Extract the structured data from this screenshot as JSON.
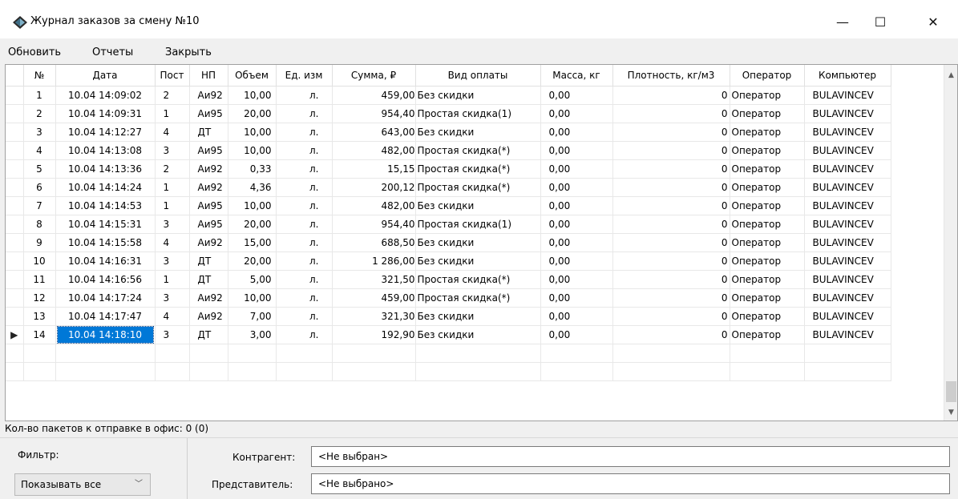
{
  "window": {
    "title": "Журнал заказов за смену №10",
    "minimize_glyph": "—",
    "maximize_glyph": "☐",
    "close_glyph": "✕"
  },
  "menu": {
    "refresh": "Обновить",
    "reports": "Отчеты",
    "close": "Закрыть"
  },
  "grid": {
    "columns": [
      "№",
      "Дата",
      "Пост",
      "НП",
      "Объем",
      "Ед. изм",
      "Сумма, ₽",
      "Вид оплаты",
      "Масса, кг",
      "Плотность, кг/м3",
      "Оператор",
      "Компьютер"
    ],
    "rows": [
      [
        "1",
        "10.04 14:09:02",
        "2",
        "Аи92",
        "10,00",
        "л.",
        "459,00",
        "Без скидки",
        "0,00",
        "0",
        "Оператор",
        "BULAVINCEV"
      ],
      [
        "2",
        "10.04 14:09:31",
        "1",
        "Аи95",
        "20,00",
        "л.",
        "954,40",
        "Простая скидка(1)",
        "0,00",
        "0",
        "Оператор",
        "BULAVINCEV"
      ],
      [
        "3",
        "10.04 14:12:27",
        "4",
        "ДТ",
        "10,00",
        "л.",
        "643,00",
        "Без скидки",
        "0,00",
        "0",
        "Оператор",
        "BULAVINCEV"
      ],
      [
        "4",
        "10.04 14:13:08",
        "3",
        "Аи95",
        "10,00",
        "л.",
        "482,00",
        "Простая скидка(*)",
        "0,00",
        "0",
        "Оператор",
        "BULAVINCEV"
      ],
      [
        "5",
        "10.04 14:13:36",
        "2",
        "Аи92",
        "0,33",
        "л.",
        "15,15",
        "Простая скидка(*)",
        "0,00",
        "0",
        "Оператор",
        "BULAVINCEV"
      ],
      [
        "6",
        "10.04 14:14:24",
        "1",
        "Аи92",
        "4,36",
        "л.",
        "200,12",
        "Простая скидка(*)",
        "0,00",
        "0",
        "Оператор",
        "BULAVINCEV"
      ],
      [
        "7",
        "10.04 14:14:53",
        "1",
        "Аи95",
        "10,00",
        "л.",
        "482,00",
        "Без скидки",
        "0,00",
        "0",
        "Оператор",
        "BULAVINCEV"
      ],
      [
        "8",
        "10.04 14:15:31",
        "3",
        "Аи95",
        "20,00",
        "л.",
        "954,40",
        "Простая скидка(1)",
        "0,00",
        "0",
        "Оператор",
        "BULAVINCEV"
      ],
      [
        "9",
        "10.04 14:15:58",
        "4",
        "Аи92",
        "15,00",
        "л.",
        "688,50",
        "Без скидки",
        "0,00",
        "0",
        "Оператор",
        "BULAVINCEV"
      ],
      [
        "10",
        "10.04 14:16:31",
        "3",
        "ДТ",
        "20,00",
        "л.",
        "1 286,00",
        "Без скидки",
        "0,00",
        "0",
        "Оператор",
        "BULAVINCEV"
      ],
      [
        "11",
        "10.04 14:16:56",
        "1",
        "ДТ",
        "5,00",
        "л.",
        "321,50",
        "Простая скидка(*)",
        "0,00",
        "0",
        "Оператор",
        "BULAVINCEV"
      ],
      [
        "12",
        "10.04 14:17:24",
        "3",
        "Аи92",
        "10,00",
        "л.",
        "459,00",
        "Простая скидка(*)",
        "0,00",
        "0",
        "Оператор",
        "BULAVINCEV"
      ],
      [
        "13",
        "10.04 14:17:47",
        "4",
        "Аи92",
        "7,00",
        "л.",
        "321,30",
        "Без скидки",
        "0,00",
        "0",
        "Оператор",
        "BULAVINCEV"
      ],
      [
        "14",
        "10.04 14:18:10",
        "3",
        "ДТ",
        "3,00",
        "л.",
        "192,90",
        "Без скидки",
        "0,00",
        "0",
        "Оператор",
        "BULAVINCEV"
      ]
    ],
    "selected_row_index": 13,
    "selected_column": "Дата",
    "selection_color": "#0078d7",
    "current_row_marker": "▶"
  },
  "status": {
    "packets_text": "Кол-во пакетов к отправке в офис: 0 (0)"
  },
  "filter": {
    "label": "Фильтр:",
    "selected": "Показывать все",
    "arrow_glyph": "﹀"
  },
  "fields": {
    "counterparty_label": "Контрагент:",
    "counterparty_value": "<Не выбран>",
    "representative_label": "Представитель:",
    "representative_value": "<Не выбрано>"
  },
  "icons": {
    "app": "diamond-app-icon",
    "scroll_up": "chevron-up-icon",
    "scroll_down": "chevron-down-icon"
  }
}
